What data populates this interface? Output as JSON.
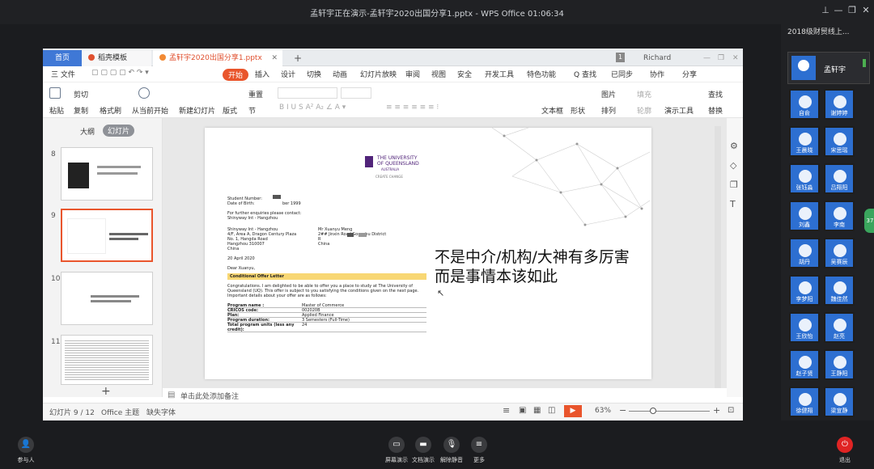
{
  "window": {
    "title": "孟轩宇正在演示-孟轩宇2020出国分享1.pptx - WPS Office 01:06:34"
  },
  "right_panel": {
    "group_title": "2018级财贸线上...",
    "presenter": "孟轩宇",
    "side_badge": "37",
    "participants": [
      "自俞",
      "谢婷婷",
      "王晨晓",
      "宋思瑶",
      "张钰淼",
      "吕翔阳",
      "刘鑫",
      "李南",
      "胡丹",
      "吴赛辰",
      "李梦阳",
      "魏佳然",
      "王欣怡",
      "赵亮",
      "赵子贤",
      "王静阳",
      "徐健翔",
      "梁宣静"
    ]
  },
  "tabs": {
    "home": "首页",
    "template": "稻壳模板",
    "file": "孟轩宇2020出国分享1.pptx",
    "add": "+",
    "badge": "1",
    "user": "Richard"
  },
  "menu": {
    "file": "三 文件",
    "start": "开始",
    "items": [
      "插入",
      "设计",
      "切换",
      "动画",
      "幻灯片放映",
      "审阅",
      "视图",
      "安全",
      "开发工具",
      "特色功能"
    ],
    "search": "Q 查找",
    "sync": "已同步",
    "collab": "协作",
    "share": "分享"
  },
  "ribbon": {
    "paste": "粘贴",
    "cut": "剪切",
    "copy": "复制",
    "format": "格式刷",
    "play": "从当前开始",
    "new_slide": "新建幻灯片",
    "layout": "版式",
    "section": "节",
    "reset": "重置",
    "textbox": "文本框",
    "shape": "形状",
    "picture": "图片",
    "fill": "填充",
    "arrange": "排列",
    "outline": "轮廓",
    "present_tools": "演示工具",
    "find": "查找",
    "replace": "替换"
  },
  "left_pane": {
    "outline_tab": "大纲",
    "slides_tab": "幻灯片",
    "add": "+",
    "slide_numbers": [
      "8",
      "9",
      "10",
      "11"
    ]
  },
  "slide": {
    "main_text": [
      "不是中介/机构/大神有多厉害",
      "而是事情本该如此"
    ],
    "uq": {
      "name1": "THE UNIVERSITY",
      "name2": "OF QUEENSLAND",
      "country": "AUSTRALIA",
      "tagline": "CREATE CHANGE"
    },
    "letter": {
      "student_number": "Student Number:",
      "dob": "Date of Birth:",
      "dob_val": "ber 1999",
      "enquiries": "For further enquiries please contact:",
      "agent": "Shinyway Int - Hangzhou",
      "addr": [
        "Shinyway Int - Hangzhou",
        "4/F, Area A, Dragon Century Plaza",
        "No. 1, Hangda Road",
        "Hangzhou 310007",
        "China"
      ],
      "to": [
        "Mr Xuanyu Meng",
        "2## Jinxin Road Gongshu District",
        "R",
        "China"
      ],
      "date": "20 April 2020",
      "dear": "Dear Xuanyu,",
      "heading": "Conditional Offer Letter",
      "body": "Congratulations. I am delighted to be able to offer you a place to study at The University of Queensland (UQ). This offer is subject to you satisfying the conditions given on the next page. Important details about your offer are as follows:",
      "table": [
        [
          "Program name :",
          "Master of Commerce"
        ],
        [
          "CRICOS code:",
          "002020B"
        ],
        [
          "Plan:",
          "Applied Finance"
        ],
        [
          "Program duration:",
          "3 Semesters (Full-Time)"
        ],
        [
          "Total program units (less any credit):",
          "24"
        ]
      ]
    }
  },
  "notes": {
    "placeholder": "单击此处添加备注"
  },
  "status": {
    "slide": "幻灯片 9 / 12",
    "theme": "Office 主题",
    "font": "缺失字体",
    "zoom": "63%"
  },
  "bottom": {
    "participants": "参与人",
    "screen": "屏幕演示",
    "doc": "文档演示",
    "mute": "解除静音",
    "more": "更多",
    "leave": "退出"
  }
}
